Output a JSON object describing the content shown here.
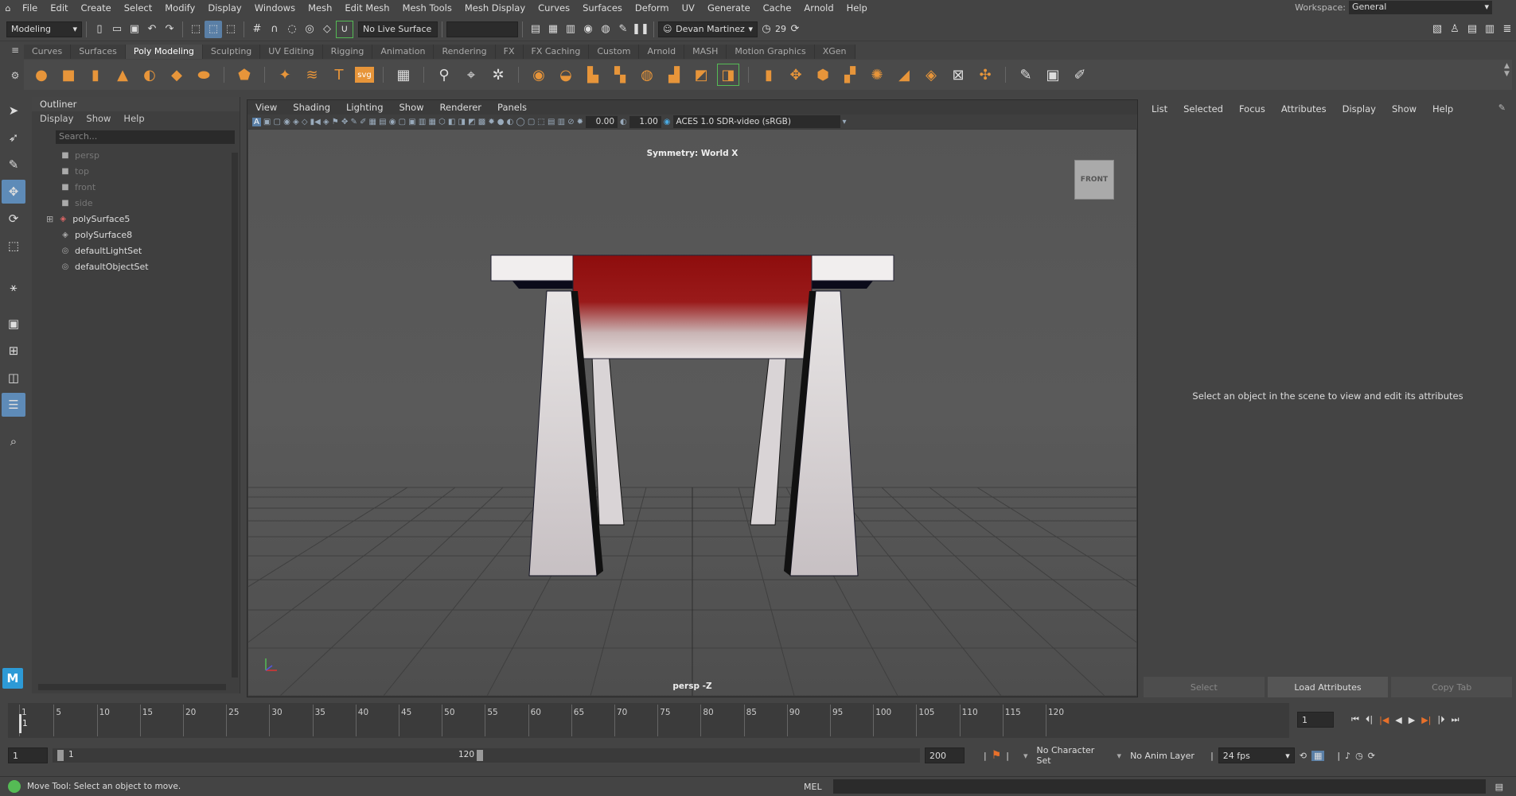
{
  "menubar": {
    "items": [
      "File",
      "Edit",
      "Create",
      "Select",
      "Modify",
      "Display",
      "Windows",
      "Mesh",
      "Edit Mesh",
      "Mesh Tools",
      "Mesh Display",
      "Curves",
      "Surfaces",
      "Deform",
      "UV",
      "Generate",
      "Cache",
      "Arnold",
      "Help"
    ],
    "workspace_label": "Workspace:",
    "workspace_value": "General"
  },
  "statusline": {
    "mode": "Modeling",
    "live_surface": "No Live Surface",
    "user": "Devan Martinez",
    "notifications": "29"
  },
  "shelf": {
    "tabs": [
      "Curves",
      "Surfaces",
      "Poly Modeling",
      "Sculpting",
      "UV Editing",
      "Rigging",
      "Animation",
      "Rendering",
      "FX",
      "FX Caching",
      "Custom",
      "Arnold",
      "MASH",
      "Motion Graphics",
      "XGen"
    ],
    "active_tab": "Poly Modeling"
  },
  "outliner": {
    "title": "Outliner",
    "menus": [
      "Display",
      "Show",
      "Help"
    ],
    "search_placeholder": "Search...",
    "items": [
      {
        "label": "persp",
        "icon": "camera-icon",
        "dim": true
      },
      {
        "label": "top",
        "icon": "camera-icon",
        "dim": true
      },
      {
        "label": "front",
        "icon": "camera-icon",
        "dim": true
      },
      {
        "label": "side",
        "icon": "camera-icon",
        "dim": true
      },
      {
        "label": "polySurface5",
        "icon": "mesh-icon",
        "dim": false,
        "expandable": true
      },
      {
        "label": "polySurface8",
        "icon": "mesh-icon",
        "dim": false
      },
      {
        "label": "defaultLightSet",
        "icon": "set-icon",
        "dim": false
      },
      {
        "label": "defaultObjectSet",
        "icon": "set-icon",
        "dim": false
      }
    ]
  },
  "viewport": {
    "menus": [
      "View",
      "Shading",
      "Lighting",
      "Show",
      "Renderer",
      "Panels"
    ],
    "exposure": "0.00",
    "gamma": "1.00",
    "color_space": "ACES 1.0 SDR-video (sRGB)",
    "symmetry": "Symmetry: World X",
    "viewcube": "FRONT",
    "camera_label": "persp -Z"
  },
  "attribute_editor": {
    "menus": [
      "List",
      "Selected",
      "Focus",
      "Attributes",
      "Display",
      "Show",
      "Help"
    ],
    "message": "Select an object in the scene to view and edit its attributes",
    "buttons": [
      "Select",
      "Load Attributes",
      "Copy Tab"
    ]
  },
  "timeline": {
    "ticks": [
      "1",
      "5",
      "10",
      "15",
      "20",
      "25",
      "30",
      "35",
      "40",
      "45",
      "50",
      "55",
      "60",
      "65",
      "70",
      "75",
      "80",
      "85",
      "90",
      "95",
      "100",
      "105",
      "110",
      "115",
      "120"
    ],
    "current_frame": "1"
  },
  "range": {
    "start": "1",
    "range_start": "1",
    "range_end": "120",
    "end": "200",
    "character_set": "No Character Set",
    "anim_layer": "No Anim Layer",
    "fps": "24 fps"
  },
  "commandline": {
    "help": "Move Tool: Select an object to move.",
    "lang": "MEL"
  }
}
